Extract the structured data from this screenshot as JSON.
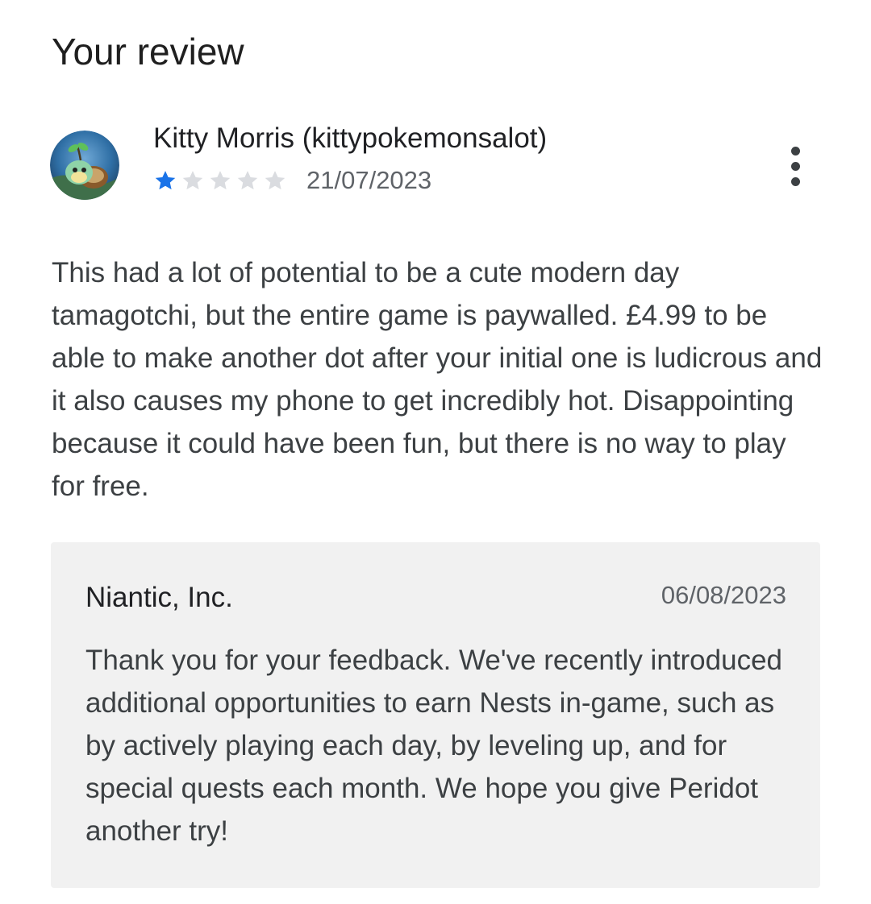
{
  "section": {
    "title": "Your review"
  },
  "review": {
    "author_name": "Kitty Morris (kittypokemonsalot)",
    "avatar_icon": "turtle-avatar-icon",
    "rating": 1,
    "rating_max": 5,
    "star_filled_color": "#1a73e8",
    "star_empty_color": "#dadce0",
    "date": "21/07/2023",
    "menu_icon": "more-vert-icon",
    "body": "This had a lot of potential to be a cute modern day tamagotchi, but the entire game is paywalled. £4.99 to be able to make another dot after your initial one is ludicrous and it also causes my phone to get incredibly hot. Disappointing because it could have been fun, but there is no way to play for free."
  },
  "developer_reply": {
    "author": "Niantic, Inc.",
    "date": "06/08/2023",
    "body": "Thank you for your feedback. We've recently introduced additional opportunities to earn Nests in-game, such as by actively playing each day, by leveling up, and for special quests each month. We hope you give Peridot another try!",
    "background_color": "#f1f1f1"
  }
}
